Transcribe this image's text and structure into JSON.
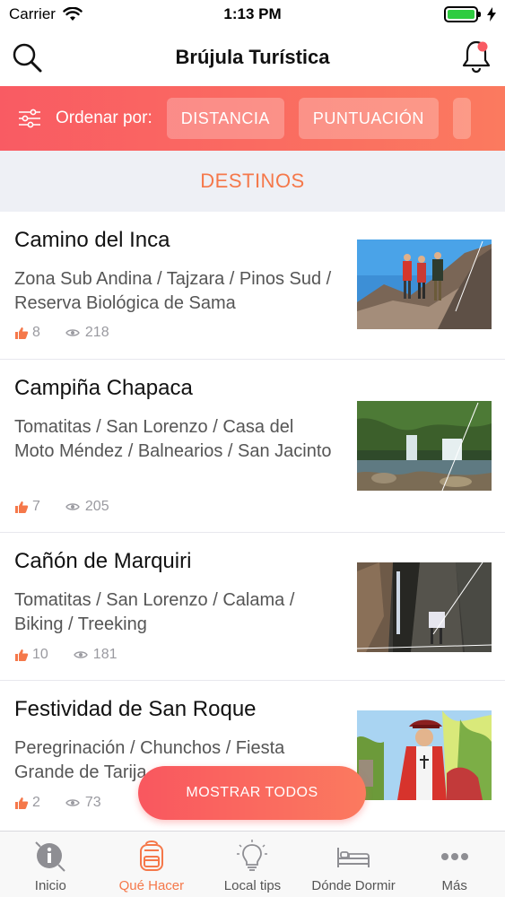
{
  "status_bar": {
    "carrier": "Carrier",
    "time": "1:13 PM",
    "battery_color": "#2ecc40"
  },
  "header": {
    "title": "Brújula Turística",
    "left_icon": "search-icon",
    "right_icon": "bell-icon"
  },
  "sort": {
    "label": "Ordenar por:",
    "options": [
      "DISTANCIA",
      "PUNTUACIÓN"
    ],
    "gradient_start": "#f95b63",
    "gradient_end": "#fb7a5f"
  },
  "section": {
    "title": "DESTINOS"
  },
  "destinations": [
    {
      "title": "Camino del Inca",
      "description": "Zona Sub Andina / Tajzara / Pinos Sud / Reserva Biológica de Sama",
      "likes": "8",
      "views": "218"
    },
    {
      "title": "Campiña Chapaca",
      "description": "Tomatitas / San Lorenzo / Casa del Moto Méndez / Balnearios / San Jacinto",
      "likes": "7",
      "views": "205"
    },
    {
      "title": "Cañón de Marquiri",
      "description": "Tomatitas / San Lorenzo / Calama / Biking / Treeking",
      "likes": "10",
      "views": "181"
    },
    {
      "title": "Festividad de San Roque",
      "description": "Peregrinación / Chunchos / Fiesta Grande de Tarija",
      "likes": "2",
      "views": "73"
    }
  ],
  "fab": {
    "label": "MOSTRAR TODOS"
  },
  "tabs": [
    {
      "label": "Inicio",
      "icon": "info-icon"
    },
    {
      "label": "Qué Hacer",
      "icon": "backpack-icon"
    },
    {
      "label": "Local tips",
      "icon": "lightbulb-icon"
    },
    {
      "label": "Dónde Dormir",
      "icon": "bed-icon"
    },
    {
      "label": "Más",
      "icon": "more-icon"
    }
  ],
  "accent_color": "#f5784a"
}
